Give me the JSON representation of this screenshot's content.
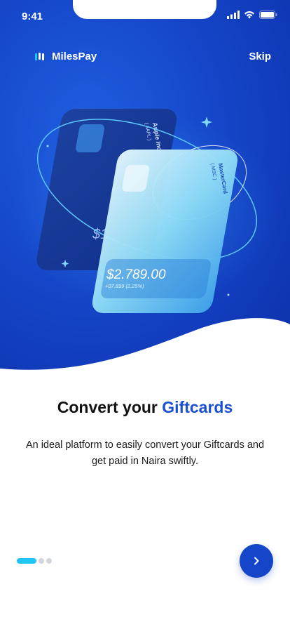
{
  "status": {
    "time": "9:41"
  },
  "brand": {
    "name": "MilesPay"
  },
  "header": {
    "skip_label": "Skip"
  },
  "card_back": {
    "name": "Apple Inc",
    "ticker": "( AAPL )",
    "amount_partial": "$1"
  },
  "card_front": {
    "name": "MasterCard",
    "ticker": "( MSC )",
    "amount": "$2.789.00",
    "change": "+07.899 (2.25%)"
  },
  "content": {
    "title_prefix": "Convert your",
    "title_accent": "Giftcards",
    "description": "An ideal platform to easily convert your Giftcards and get paid in Naira swiftly."
  },
  "pager": {
    "count": 3,
    "active_index": 0
  },
  "colors": {
    "primary": "#1546c9",
    "accent": "#22c4f4",
    "title_accent": "#1a4fcf"
  },
  "icons": {
    "next": "chevron-right-icon",
    "logo": "milespay-logo-icon"
  }
}
